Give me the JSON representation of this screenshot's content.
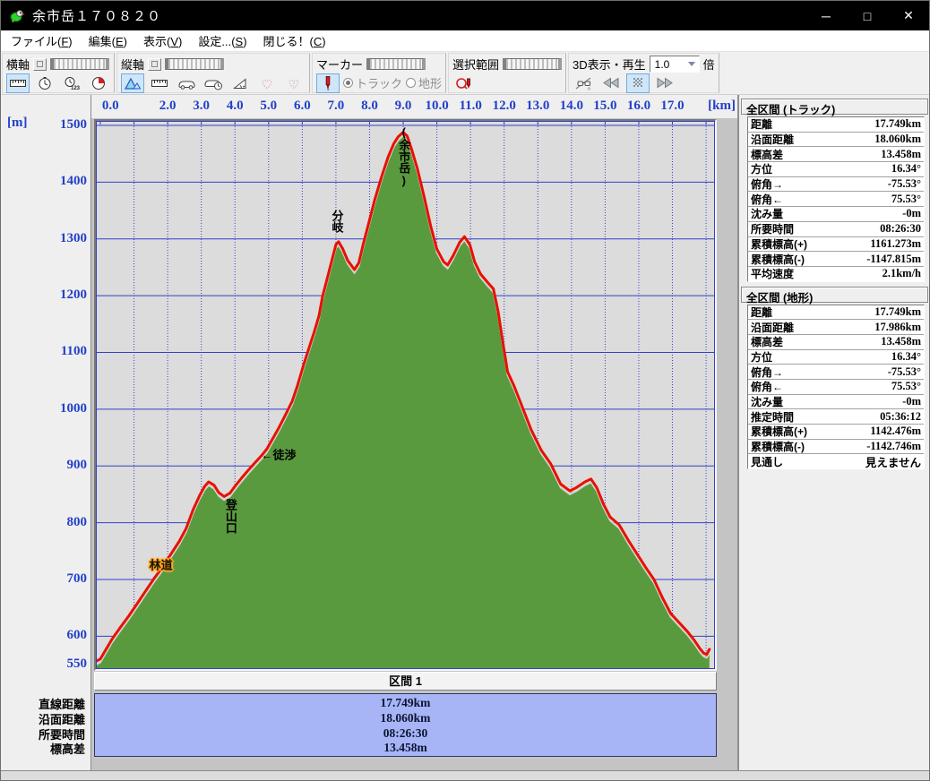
{
  "window": {
    "title": "余市岳１７０８２０",
    "controls": {
      "minimize": "─",
      "maximize": "□",
      "close": "✕"
    }
  },
  "menu": {
    "items": [
      {
        "pre": "ファイル(",
        "key": "F",
        "post": ")"
      },
      {
        "pre": "編集(",
        "key": "E",
        "post": ")"
      },
      {
        "pre": "表示(",
        "key": "V",
        "post": ")"
      },
      {
        "pre": "設定...(",
        "key": "S",
        "post": ")"
      },
      {
        "pre": "閉じる！(",
        "key": "C",
        "post": ")"
      }
    ]
  },
  "toolbar": {
    "haxis": {
      "label": "横軸",
      "icons": [
        "ruler-icon",
        "clock-icon",
        "clock-123-icon",
        "pie-timer-icon"
      ],
      "selected": "ruler-icon"
    },
    "vaxis": {
      "label": "縦軸",
      "icons": [
        "mountain-icon",
        "ruler-icon",
        "speed-icon",
        "speed-clock-icon",
        "slope-icon",
        "heart-icon",
        "heart2-icon"
      ],
      "selected": "mountain-icon"
    },
    "marker": {
      "label": "マーカー",
      "pen_icon": "marker-pen-icon",
      "radio_track": "トラック",
      "radio_terrain": "地形",
      "radio_selected": "トラック"
    },
    "selection": {
      "label": "選択範囲",
      "icon": "lasso-pen-icon"
    },
    "playback": {
      "label": "3D表示・再生",
      "speed_value": "1.0",
      "speed_unit": "倍",
      "icons": [
        "3d-view-icon",
        "rewind-icon",
        "pause-grid-icon",
        "forward-icon"
      ],
      "selected": "pause-grid-icon"
    }
  },
  "panel_track": {
    "title": "全区間 (トラック)",
    "rows": [
      [
        "距離",
        "17.749km"
      ],
      [
        "沿面距離",
        "18.060km"
      ],
      [
        "標高差",
        "13.458m"
      ],
      [
        "方位",
        "16.34°"
      ],
      [
        "俯角→",
        "-75.53°"
      ],
      [
        "俯角←",
        "75.53°"
      ],
      [
        "沈み量",
        "-0m"
      ],
      [
        "所要時間",
        "08:26:30"
      ],
      [
        "累積標高(+)",
        "1161.273m"
      ],
      [
        "累積標高(-)",
        "-1147.815m"
      ],
      [
        "平均速度",
        "2.1km/h"
      ]
    ]
  },
  "panel_terrain": {
    "title": "全区間 (地形)",
    "rows": [
      [
        "距離",
        "17.749km"
      ],
      [
        "沿面距離",
        "17.986km"
      ],
      [
        "標高差",
        "13.458m"
      ],
      [
        "方位",
        "16.34°"
      ],
      [
        "俯角→",
        "-75.53°"
      ],
      [
        "俯角←",
        "75.53°"
      ],
      [
        "沈み量",
        "-0m"
      ],
      [
        "推定時間",
        "05:36:12"
      ],
      [
        "累積標高(+)",
        "1142.476m"
      ],
      [
        "累積標高(-)",
        "-1142.746m"
      ],
      [
        "見通し",
        "見えません"
      ]
    ]
  },
  "section": {
    "header": "区間 1",
    "rows": [
      [
        "直線距離",
        "17.749km"
      ],
      [
        "沿面距離",
        "18.060km"
      ],
      [
        "所要時間",
        "08:26:30"
      ],
      [
        "標高差",
        "13.458m"
      ]
    ]
  },
  "chart_data": {
    "type": "area",
    "title": "",
    "xlabel": "[km]",
    "ylabel": "[m]",
    "x_range": [
      0,
      18.26
    ],
    "y_range": [
      550,
      1500
    ],
    "x_grid_step": 1,
    "y_grid_step": 100,
    "grid": "on",
    "colors": {
      "fill": "#5a9a3e",
      "track_line": "#e81000",
      "terrain_edge": "#d4d4cc",
      "grid_blue": "#3240c8",
      "plot_bg": "#dcdcdc",
      "tick_text": "#2340c8"
    },
    "x_ticks": [
      {
        "km": 0.3,
        "label": "0.0"
      },
      {
        "km": 2,
        "label": "2.0"
      },
      {
        "km": 3,
        "label": "3.0"
      },
      {
        "km": 4,
        "label": "4.0"
      },
      {
        "km": 5,
        "label": "5.0"
      },
      {
        "km": 6,
        "label": "6.0"
      },
      {
        "km": 7,
        "label": "7.0"
      },
      {
        "km": 8,
        "label": "8.0"
      },
      {
        "km": 9,
        "label": "9.0"
      },
      {
        "km": 10,
        "label": "10.0"
      },
      {
        "km": 11,
        "label": "11.0"
      },
      {
        "km": 12,
        "label": "12.0"
      },
      {
        "km": 13,
        "label": "13.0"
      },
      {
        "km": 14,
        "label": "14.0"
      },
      {
        "km": 15,
        "label": "15.0"
      },
      {
        "km": 16,
        "label": "16.0"
      },
      {
        "km": 17,
        "label": "17.0"
      }
    ],
    "y_ticks": [
      {
        "m": 1500,
        "label": "1500"
      },
      {
        "m": 1400,
        "label": "1400"
      },
      {
        "m": 1300,
        "label": "1300"
      },
      {
        "m": 1200,
        "label": "1200"
      },
      {
        "m": 1100,
        "label": "1100"
      },
      {
        "m": 1000,
        "label": "1000"
      },
      {
        "m": 900,
        "label": "900"
      },
      {
        "m": 800,
        "label": "800"
      },
      {
        "m": 700,
        "label": "700"
      },
      {
        "m": 600,
        "label": "600"
      },
      {
        "m": 550,
        "label": "550"
      }
    ],
    "series": [
      {
        "name": "トラック",
        "role": "track",
        "points": [
          [
            -0.12,
            556
          ],
          [
            0.0,
            560
          ],
          [
            0.15,
            575
          ],
          [
            0.35,
            595
          ],
          [
            0.6,
            616
          ],
          [
            0.85,
            636
          ],
          [
            1.1,
            658
          ],
          [
            1.35,
            680
          ],
          [
            1.6,
            702
          ],
          [
            1.85,
            722
          ],
          [
            2.1,
            745
          ],
          [
            2.35,
            768
          ],
          [
            2.55,
            790
          ],
          [
            2.75,
            822
          ],
          [
            2.95,
            848
          ],
          [
            3.1,
            864
          ],
          [
            3.22,
            872
          ],
          [
            3.38,
            866
          ],
          [
            3.52,
            853
          ],
          [
            3.68,
            846
          ],
          [
            3.85,
            852
          ],
          [
            4.0,
            864
          ],
          [
            4.2,
            879
          ],
          [
            4.4,
            893
          ],
          [
            4.6,
            906
          ],
          [
            4.8,
            919
          ],
          [
            4.95,
            930
          ],
          [
            5.1,
            946
          ],
          [
            5.3,
            967
          ],
          [
            5.5,
            990
          ],
          [
            5.7,
            1014
          ],
          [
            5.85,
            1040
          ],
          [
            6.05,
            1080
          ],
          [
            6.2,
            1108
          ],
          [
            6.35,
            1135
          ],
          [
            6.5,
            1165
          ],
          [
            6.6,
            1198
          ],
          [
            6.75,
            1232
          ],
          [
            6.88,
            1262
          ],
          [
            7.0,
            1290
          ],
          [
            7.08,
            1295
          ],
          [
            7.2,
            1283
          ],
          [
            7.35,
            1262
          ],
          [
            7.55,
            1246
          ],
          [
            7.68,
            1258
          ],
          [
            7.8,
            1288
          ],
          [
            7.95,
            1322
          ],
          [
            8.15,
            1368
          ],
          [
            8.35,
            1408
          ],
          [
            8.55,
            1444
          ],
          [
            8.72,
            1468
          ],
          [
            8.85,
            1480
          ],
          [
            9.0,
            1488
          ],
          [
            9.12,
            1481
          ],
          [
            9.25,
            1458
          ],
          [
            9.42,
            1424
          ],
          [
            9.62,
            1375
          ],
          [
            9.82,
            1322
          ],
          [
            10.0,
            1282
          ],
          [
            10.2,
            1260
          ],
          [
            10.32,
            1254
          ],
          [
            10.48,
            1270
          ],
          [
            10.68,
            1294
          ],
          [
            10.82,
            1304
          ],
          [
            10.98,
            1290
          ],
          [
            11.12,
            1260
          ],
          [
            11.3,
            1238
          ],
          [
            11.5,
            1224
          ],
          [
            11.68,
            1212
          ],
          [
            11.82,
            1172
          ],
          [
            11.95,
            1122
          ],
          [
            12.1,
            1066
          ],
          [
            12.3,
            1040
          ],
          [
            12.55,
            1002
          ],
          [
            12.8,
            964
          ],
          [
            13.1,
            928
          ],
          [
            13.38,
            904
          ],
          [
            13.68,
            868
          ],
          [
            13.95,
            856
          ],
          [
            14.15,
            862
          ],
          [
            14.4,
            872
          ],
          [
            14.58,
            877
          ],
          [
            14.75,
            862
          ],
          [
            14.95,
            833
          ],
          [
            15.15,
            810
          ],
          [
            15.42,
            796
          ],
          [
            15.7,
            768
          ],
          [
            16.0,
            740
          ],
          [
            16.22,
            720
          ],
          [
            16.45,
            700
          ],
          [
            16.7,
            668
          ],
          [
            16.95,
            640
          ],
          [
            17.2,
            624
          ],
          [
            17.45,
            608
          ],
          [
            17.65,
            593
          ],
          [
            17.82,
            578
          ],
          [
            17.93,
            570
          ],
          [
            18.02,
            568
          ],
          [
            18.1,
            577
          ]
        ]
      },
      {
        "name": "地形",
        "role": "terrain",
        "offset_m": -6
      }
    ],
    "annotations": [
      {
        "text": "林道",
        "km": 1.8,
        "m": 727,
        "mode": "badge"
      },
      {
        "text": "登山口",
        "km": 3.87,
        "m": 842,
        "mode": "vertical"
      },
      {
        "text": "←徒渉",
        "km": 4.78,
        "m": 921,
        "mode": "plain"
      },
      {
        "text": "分岐",
        "km": 7.03,
        "m": 1352,
        "mode": "vertical"
      },
      {
        "text": "(余市岳)",
        "km": 9.02,
        "m": 1500,
        "mode": "vertical"
      }
    ]
  }
}
